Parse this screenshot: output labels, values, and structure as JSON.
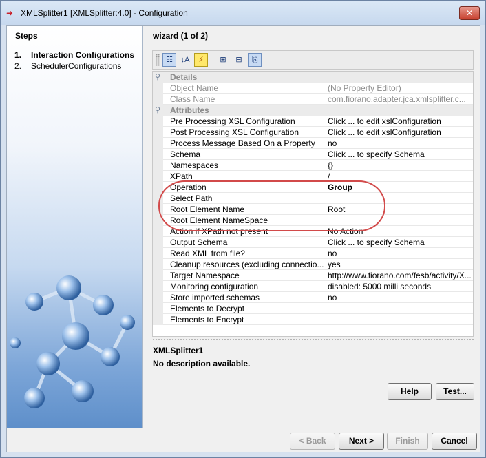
{
  "window": {
    "title": "XMLSplitter1 [XMLSplitter:4.0] - Configuration",
    "close_glyph": "✕"
  },
  "steps": {
    "title": "Steps",
    "items": [
      {
        "num": "1.",
        "label": "Interaction Configurations",
        "active": true
      },
      {
        "num": "2.",
        "label": "SchedulerConfigurations",
        "active": false
      }
    ]
  },
  "wizard": {
    "title": "wizard (1 of 2)"
  },
  "toolbar": {
    "buttons": [
      {
        "name": "categorized-view-icon",
        "glyph": "☷"
      },
      {
        "name": "sort-alphabetical-icon",
        "glyph": "↓A"
      },
      {
        "name": "lightning-icon",
        "glyph": "⚡"
      },
      {
        "name": "expand-all-icon",
        "glyph": "⊞"
      },
      {
        "name": "collapse-all-icon",
        "glyph": "⊟"
      },
      {
        "name": "description-toggle-icon",
        "glyph": "⎘"
      }
    ]
  },
  "properties": {
    "categories": {
      "details": "Details",
      "attributes": "Attributes"
    },
    "details": [
      {
        "name": "Object Name",
        "value": "(No Property Editor)"
      },
      {
        "name": "Class Name",
        "value": "com.fiorano.adapter.jca.xmlsplitter.c..."
      }
    ],
    "attributes": [
      {
        "name": "Pre Processing XSL Configuration",
        "value": "Click ... to edit xslConfiguration"
      },
      {
        "name": "Post Processing XSL Configuration",
        "value": "Click ... to edit xslConfiguration"
      },
      {
        "name": "Process Message Based On a Property",
        "value": "no"
      },
      {
        "name": "Schema",
        "value": "Click ... to specify Schema"
      },
      {
        "name": "Namespaces",
        "value": "{}"
      },
      {
        "name": "XPath",
        "value": "/"
      },
      {
        "name": "Operation",
        "value": "Group"
      },
      {
        "name": "Select Path",
        "value": ""
      },
      {
        "name": "Root Element Name",
        "value": "Root"
      },
      {
        "name": "Root Element NameSpace",
        "value": ""
      },
      {
        "name": "Action if XPath not present",
        "value": "No Action"
      },
      {
        "name": "Output Schema",
        "value": "Click ... to specify Schema"
      },
      {
        "name": "Read XML from file?",
        "value": "no"
      },
      {
        "name": "Cleanup resources (excluding connectio...",
        "value": "yes"
      },
      {
        "name": "Target Namespace",
        "value": "http://www.fiorano.com/fesb/activity/X..."
      },
      {
        "name": "Monitoring configuration",
        "value": "disabled: 5000 milli seconds"
      },
      {
        "name": "Store imported schemas",
        "value": "no"
      },
      {
        "name": "Elements to Decrypt",
        "value": ""
      },
      {
        "name": "Elements to Encrypt",
        "value": ""
      }
    ]
  },
  "description": {
    "title": "XMLSplitter1",
    "text": "No description available."
  },
  "buttons": {
    "help": "Help",
    "test": "Test...",
    "back": "< Back",
    "next": "Next >",
    "finish": "Finish",
    "cancel": "Cancel"
  },
  "colors": {
    "highlight": "#d24a4a",
    "title_bar": "#c6d8ee"
  }
}
